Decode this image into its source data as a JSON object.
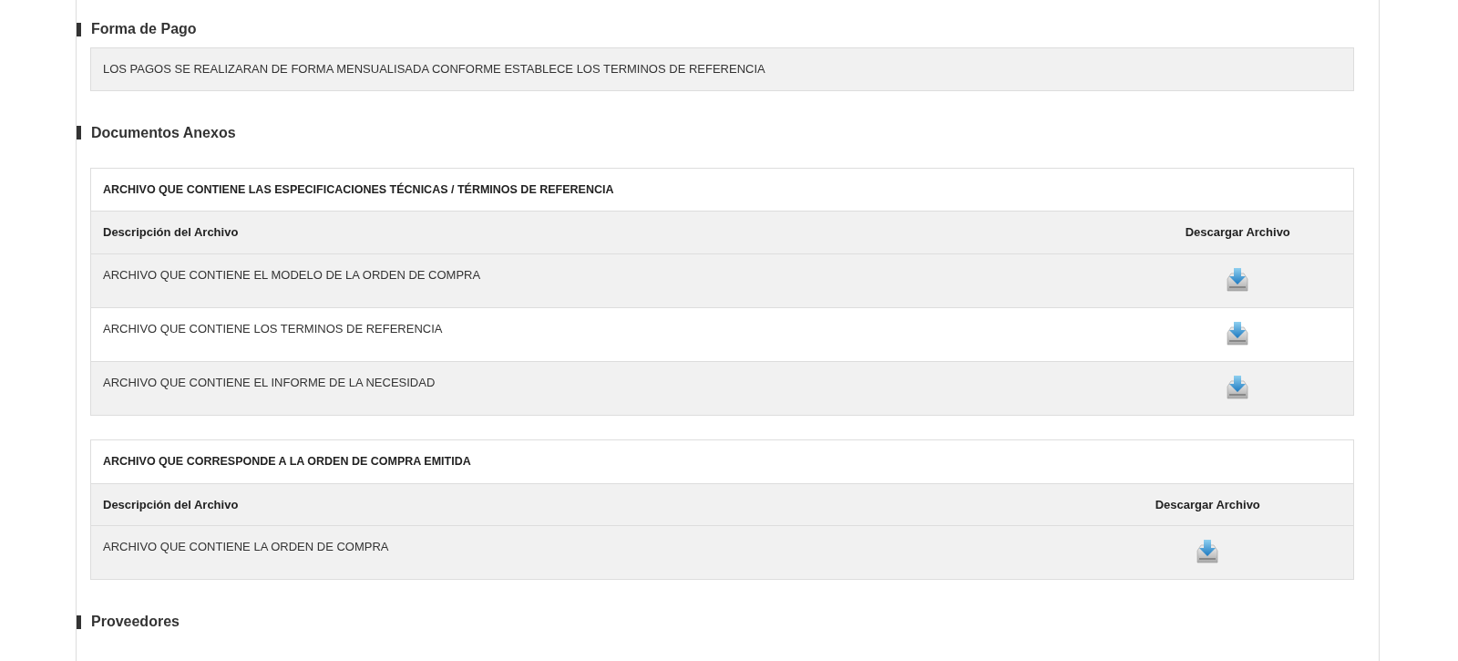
{
  "sections": [
    {
      "title": "Forma de Pago",
      "kind": "text",
      "text": "LOS PAGOS SE REALIZARAN DE FORMA MENSUALISADA CONFORME ESTABLECE LOS TERMINOS DE REFERENCIA"
    },
    {
      "title": "Documentos Anexos",
      "kind": "tables",
      "tables": [
        {
          "caption": "ARCHIVO QUE CONTIENE LAS ESPECIFICACIONES TÉCNICAS / TÉRMINOS DE REFERENCIA",
          "columns": [
            "Descripción del Archivo",
            "Descargar Archivo"
          ],
          "rows": [
            {
              "description": "ARCHIVO QUE CONTIENE EL MODELO DE LA ORDEN DE COMPRA"
            },
            {
              "description": "ARCHIVO QUE CONTIENE LOS TERMINOS DE REFERENCIA"
            },
            {
              "description": "ARCHIVO QUE CONTIENE EL INFORME DE LA NECESIDAD"
            }
          ]
        },
        {
          "caption": "ARCHIVO QUE CORRESPONDE A LA ORDEN DE COMPRA EMITIDA",
          "columns": [
            "Descripción del Archivo",
            "Descargar Archivo"
          ],
          "rows": [
            {
              "description": "ARCHIVO QUE CONTIENE LA ORDEN DE COMPRA"
            }
          ]
        }
      ]
    },
    {
      "title": "Proveedores",
      "kind": "heading"
    }
  ]
}
